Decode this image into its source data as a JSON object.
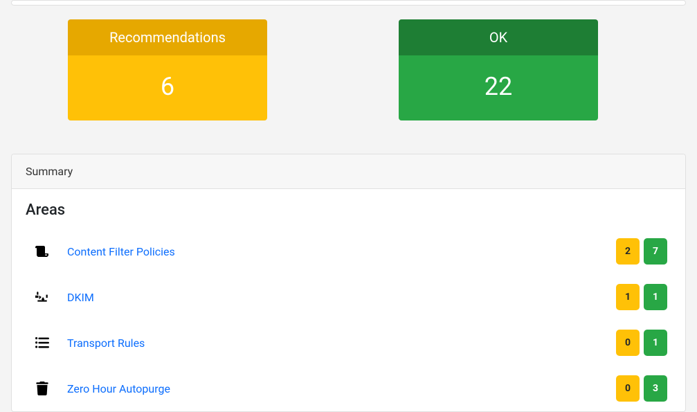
{
  "stats": {
    "recommendations": {
      "label": "Recommendations",
      "value": "6"
    },
    "ok": {
      "label": "OK",
      "value": "22"
    }
  },
  "summary": {
    "header": "Summary",
    "areas_title": "Areas",
    "areas": [
      {
        "label": "Content Filter Policies",
        "warn": "2",
        "ok": "7",
        "icon": "scroll"
      },
      {
        "label": "DKIM",
        "warn": "1",
        "ok": "1",
        "icon": "signature"
      },
      {
        "label": "Transport Rules",
        "warn": "0",
        "ok": "1",
        "icon": "list"
      },
      {
        "label": "Zero Hour Autopurge",
        "warn": "0",
        "ok": "3",
        "icon": "trash"
      }
    ]
  }
}
